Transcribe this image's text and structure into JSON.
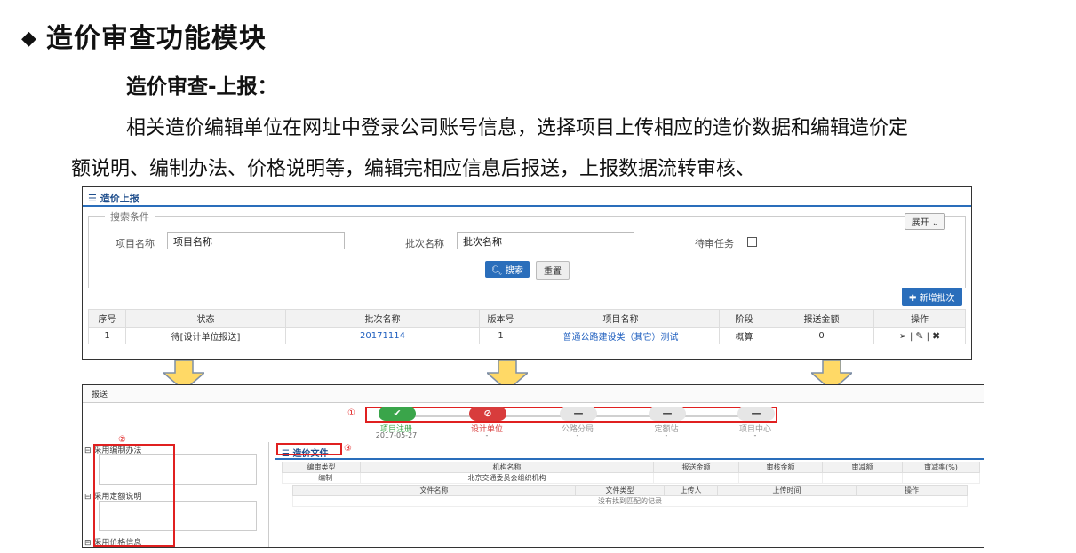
{
  "slide": {
    "heading": "造价审查功能模块",
    "subheading": "造价审查-上报：",
    "para1": "相关造价编辑单位在网址中登录公司账号信息，选择项目上传相应的造价数据和编辑造价定",
    "para2": "额说明、编制办法、价格说明等，编辑完相应信息后报送，上报数据流转审核、"
  },
  "shot1": {
    "title": "造价上报",
    "search_legend": "搜索条件",
    "expand_label": "展开",
    "project_name_label": "项目名称",
    "project_name_value": "项目名称",
    "batch_name_label": "批次名称",
    "batch_name_value": "批次名称",
    "pending_label": "待审任务",
    "search_button": "搜索",
    "reset_button": "重置",
    "new_batch_button": "新增批次",
    "columns": [
      "序号",
      "状态",
      "批次名称",
      "版本号",
      "项目名称",
      "阶段",
      "报送金额",
      "操作"
    ],
    "row": {
      "index": "1",
      "status": "待[设计单位报送]",
      "batch": "20171114",
      "version": "1",
      "project": "普通公路建设类（其它）测试",
      "stage": "概算",
      "amount": "0"
    }
  },
  "shot2": {
    "title": "报送",
    "steps": [
      {
        "symbol": "✔",
        "label": "项目注册",
        "date": "2017-05-27"
      },
      {
        "symbol": "⊘",
        "label": "设计单位",
        "date": "-"
      },
      {
        "symbol": "—",
        "label": "公路分局",
        "date": "-"
      },
      {
        "symbol": "—",
        "label": "定额站",
        "date": "-"
      },
      {
        "symbol": "—",
        "label": "项目中心",
        "date": "-"
      }
    ],
    "marker1": "①",
    "marker2": "②",
    "marker3": "③",
    "left_items": [
      "采用编制办法",
      "采用定额说明",
      "采用价格信息"
    ],
    "tab_title": "造价文件",
    "table1_columns": [
      "编审类型",
      "机构名称",
      "报送金额",
      "审核金额",
      "审减额",
      "审减率(%)"
    ],
    "table1_row": {
      "type": "编制",
      "org": "北京交通委员会组织机构"
    },
    "table2_columns": [
      "文件名称",
      "文件类型",
      "上传人",
      "上传时间",
      "操作"
    ],
    "empty_message": "没有找到匹配的记录"
  },
  "colors": {
    "accent": "#2a6ebb",
    "success": "#3aa54a",
    "danger": "#d83c3c",
    "marker": "#e02020",
    "arrow": "#ffd966"
  }
}
